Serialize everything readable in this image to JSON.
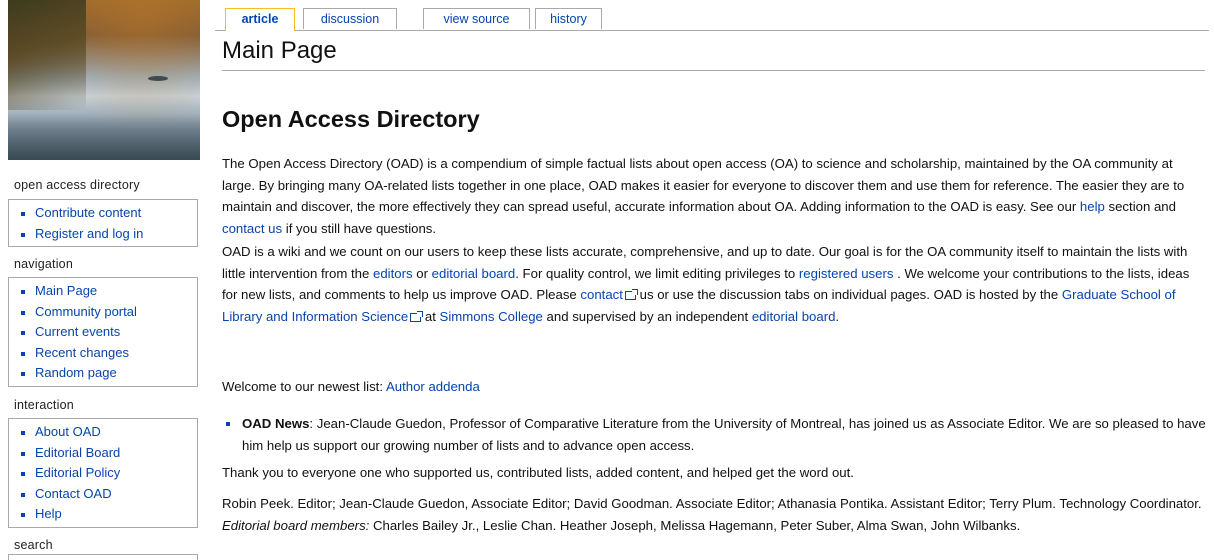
{
  "tabs": [
    {
      "label": "article",
      "selected": true
    },
    {
      "label": "discussion",
      "selected": false
    },
    {
      "label": "view source",
      "selected": false
    },
    {
      "label": "history",
      "selected": false
    }
  ],
  "sidebar": {
    "portlets": [
      {
        "title": "open access directory",
        "items": [
          "Contribute content",
          "Register and log in"
        ]
      },
      {
        "title": "navigation",
        "items": [
          "Main Page",
          "Community portal",
          "Current events",
          "Recent changes",
          "Random page"
        ]
      },
      {
        "title": "interaction",
        "items": [
          "About OAD",
          "Editorial Board",
          "Editorial Policy",
          "Contact OAD",
          "Help"
        ]
      },
      {
        "title": "search",
        "items": []
      }
    ]
  },
  "page": {
    "title": "Main Page",
    "heading": "Open Access Directory",
    "intro": {
      "t1": "The Open Access Directory (OAD) is a compendium of simple factual lists about open access (OA) to science and scholarship, maintained by the OA community at large. By bringing many OA-related lists together in one place, OAD makes it easier for everyone to discover them and use them for reference. The easier they are to maintain and discover, the more effectively they can spread useful, accurate information about OA. Adding information to the OAD is easy. See our ",
      "help_link": "help",
      "t2": " section and ",
      "contact_link": "contact us",
      "t3": " if you still have questions."
    },
    "wiki": {
      "t1": "OAD is a wiki and we count on our users to keep these lists accurate, comprehensive, and up to date. Our goal is for the OA community itself to maintain the lists with little intervention from the ",
      "editors_link": "editors",
      "t2": " or ",
      "board_link": "editorial board",
      "t3": ". For quality control, we limit editing privileges to ",
      "registered_link": "registered users",
      "t4": " . We welcome your contributions to the lists, ideas for new lists, and comments to help us improve OAD. Please ",
      "contact_link": "contact",
      "t5": " us or use the discussion tabs on individual pages. OAD is hosted by the ",
      "gslis_link": "Graduate School of Library and Information Science",
      "t6": " at ",
      "simmons_link": "Simmons College",
      "t7": " and supervised by an independent ",
      "board2_link": "editorial board",
      "t8": "."
    },
    "welcome": {
      "text": "Welcome to our newest list: ",
      "link": "Author addenda"
    },
    "news": {
      "label": "OAD News",
      "text": ": Jean-Claude Guedon, Professor of Comparative Literature from the University of Montreal, has joined us as Associate Editor. We are so pleased to have him help us support our growing number of lists and to advance open access."
    },
    "thanks": "Thank you to everyone one who supported us, contributed lists, added content, and helped get the word out.",
    "credits": {
      "t1": "Robin Peek. Editor; Jean-Claude Guedon, Associate Editor; David Goodman. Associate Editor; Athanasia Pontika. Assistant Editor; Terry Plum. Technology Coordinator. ",
      "italic": "Editorial board members:",
      "t2": " Charles Bailey Jr., Leslie Chan. Heather Joseph, Melissa Hagemann, Peter Suber, Alma Swan, John Wilbanks."
    }
  },
  "colors": {
    "link": "#0645ad",
    "selected_tab": "#fabd23",
    "border": "#aaaaaa"
  }
}
